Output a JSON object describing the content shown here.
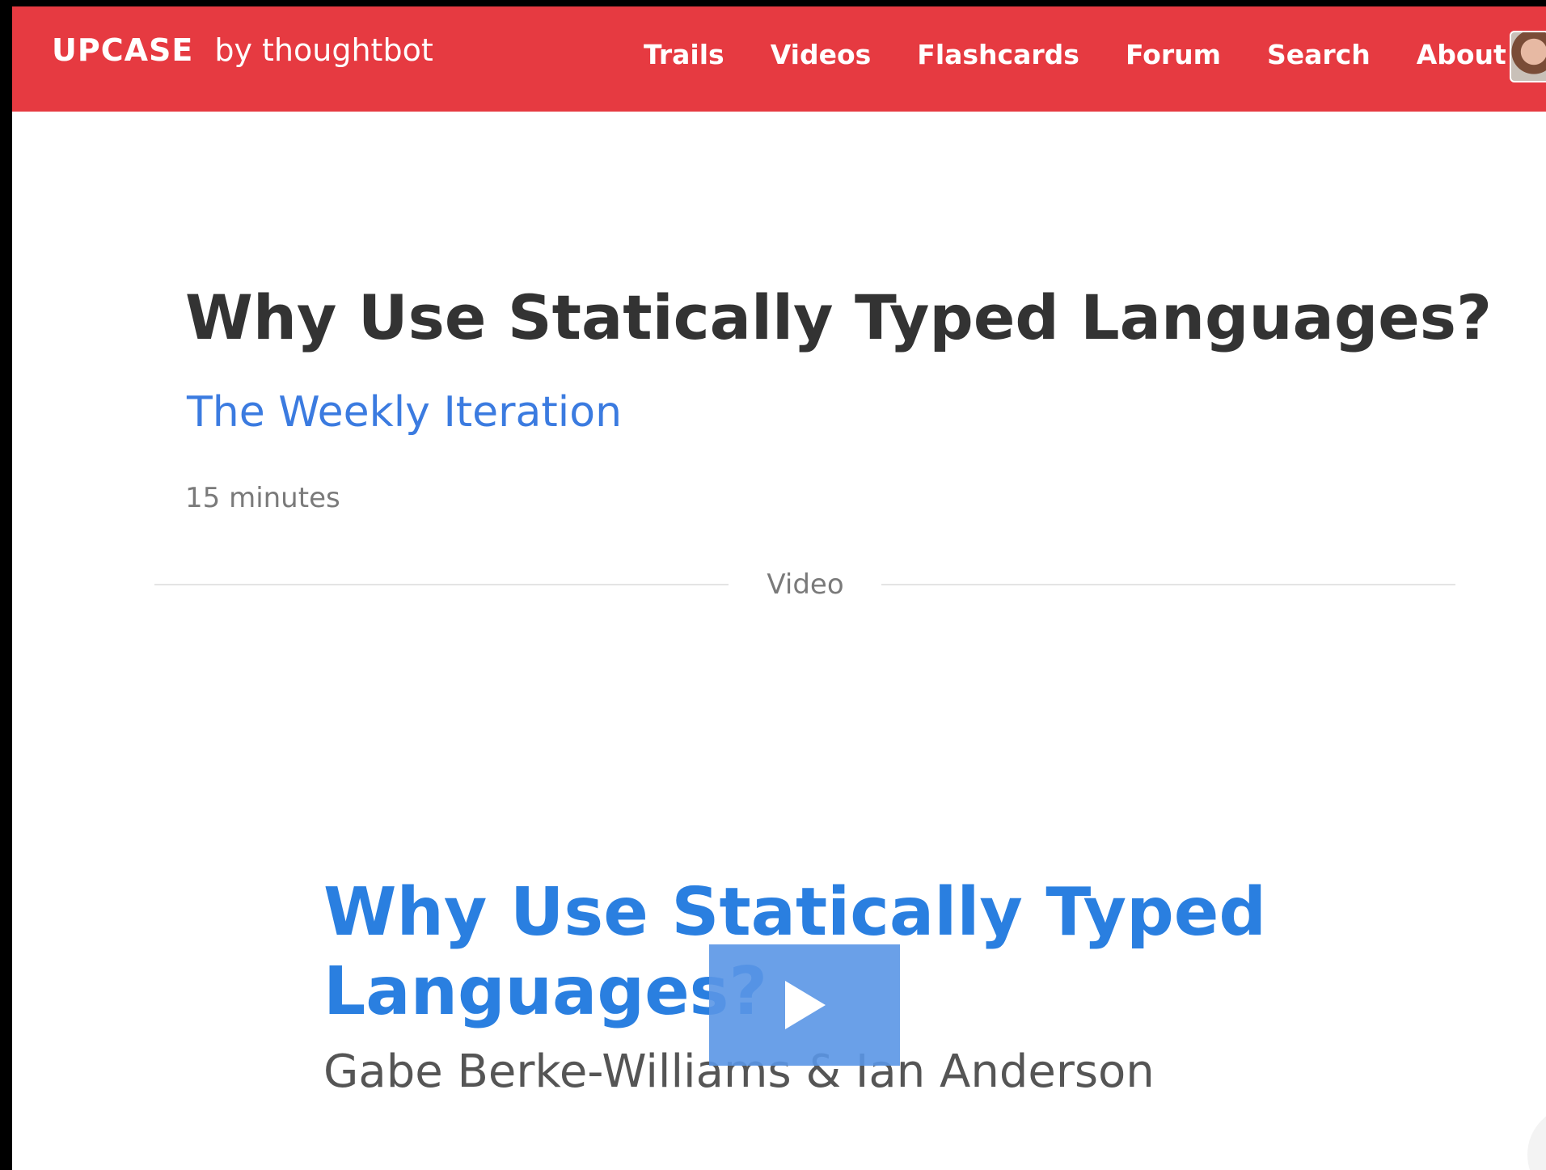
{
  "header": {
    "logo_text": "UPCASE",
    "logo_by": "by thoughtbot",
    "nav": [
      {
        "label": "Trails"
      },
      {
        "label": "Videos"
      },
      {
        "label": "Flashcards"
      },
      {
        "label": "Forum"
      },
      {
        "label": "Search"
      },
      {
        "label": "About Us"
      }
    ],
    "brand_color": "#e63a41"
  },
  "main": {
    "title": "Why Use Statically Typed Languages?",
    "series": "The Weekly Iteration",
    "duration": "15 minutes",
    "section_label": "Video"
  },
  "video": {
    "title": "Why Use Statically Typed Languages?",
    "authors": "Gabe Berke-Williams & Ian Anderson",
    "title_color": "#2a7fe0",
    "play_icon": "play-icon"
  }
}
